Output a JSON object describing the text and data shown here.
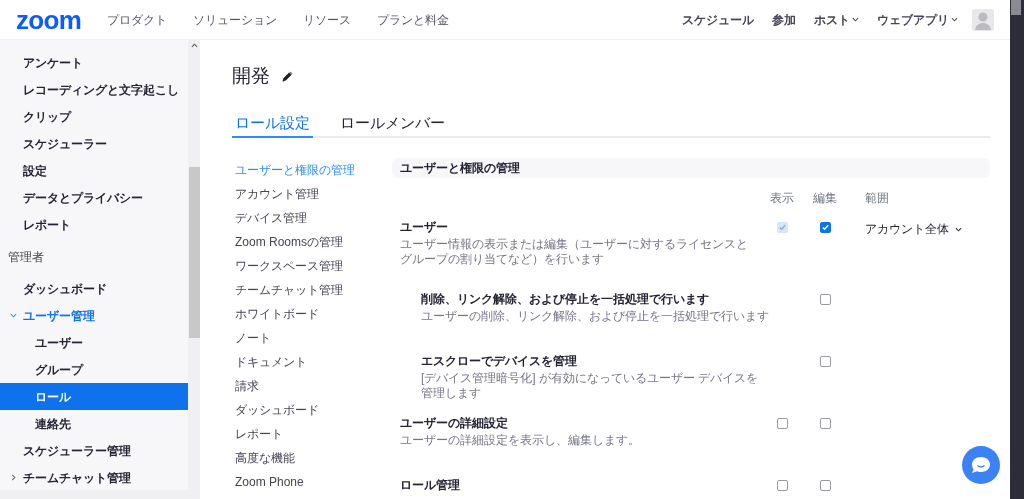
{
  "header": {
    "logo": "zoom",
    "nav_left": [
      "プロダクト",
      "ソリューション",
      "リソース",
      "プランと料金"
    ],
    "nav_right": [
      {
        "label": "スケジュール",
        "dropdown": false
      },
      {
        "label": "参加",
        "dropdown": false
      },
      {
        "label": "ホスト",
        "dropdown": true
      },
      {
        "label": "ウェブアプリ",
        "dropdown": true
      }
    ]
  },
  "sidebar": {
    "items": [
      {
        "kind": "item",
        "label": "アンケート",
        "selected": false
      },
      {
        "kind": "item",
        "label": "レコーディングと文字起こし",
        "selected": false
      },
      {
        "kind": "item",
        "label": "クリップ",
        "selected": false
      },
      {
        "kind": "item",
        "label": "スケジューラー",
        "selected": false
      },
      {
        "kind": "item",
        "label": "設定",
        "selected": false
      },
      {
        "kind": "item",
        "label": "データとプライバシー",
        "selected": false
      },
      {
        "kind": "item",
        "label": "レポート",
        "selected": false
      },
      {
        "kind": "section",
        "label": "管理者"
      },
      {
        "kind": "item",
        "label": "ダッシュボード",
        "selected": false
      },
      {
        "kind": "group",
        "label": "ユーザー管理",
        "expanded": true,
        "children": [
          {
            "kind": "item",
            "label": "ユーザー",
            "selected": false
          },
          {
            "kind": "item",
            "label": "グループ",
            "selected": false
          },
          {
            "kind": "item",
            "label": "ロール",
            "selected": true
          },
          {
            "kind": "item",
            "label": "連絡先",
            "selected": false
          }
        ]
      },
      {
        "kind": "item",
        "label": "スケジューラー管理",
        "selected": false
      },
      {
        "kind": "group",
        "label": "チームチャット管理",
        "expanded": false
      }
    ]
  },
  "page_title": "開発",
  "tabs": [
    {
      "label": "ロール設定",
      "selected": true
    },
    {
      "label": "ロールメンバー",
      "selected": false
    }
  ],
  "subnav": [
    {
      "label": "ユーザーと権限の管理",
      "selected": true
    },
    {
      "label": "アカウント管理",
      "selected": false
    },
    {
      "label": "デバイス管理",
      "selected": false
    },
    {
      "label": "Zoom Roomsの管理",
      "selected": false
    },
    {
      "label": "ワークスペース管理",
      "selected": false
    },
    {
      "label": "チームチャット管理",
      "selected": false
    },
    {
      "label": "ホワイトボード",
      "selected": false
    },
    {
      "label": "ノート",
      "selected": false
    },
    {
      "label": "ドキュメント",
      "selected": false
    },
    {
      "label": "請求",
      "selected": false
    },
    {
      "label": "ダッシュボード",
      "selected": false
    },
    {
      "label": "レポート",
      "selected": false
    },
    {
      "label": "高度な機能",
      "selected": false
    },
    {
      "label": "Zoom Phone",
      "selected": false
    }
  ],
  "section": {
    "title": "ユーザーと権限の管理",
    "columns": [
      "表示",
      "編集",
      "範囲"
    ],
    "permissions": [
      {
        "kind": "main",
        "title": "ユーザー",
        "description": "ユーザー情報の表示または編集（ユーザーに対するライセンスとグループの割り当てなど）を行います",
        "view": {
          "checked": true,
          "disabled": true
        },
        "edit": {
          "checked": true,
          "disabled": false
        },
        "scope": "アカウント全体"
      },
      {
        "kind": "sub",
        "title": "削除、リンク解除、および停止を一括処理で行います",
        "description": "ユーザーの削除、リンク解除、および停止を一括処理で行います",
        "edit": {
          "checked": false,
          "disabled": false
        }
      },
      {
        "kind": "sub",
        "title": "エスクローでデバイスを管理",
        "description": "[デバイス管理暗号化] が有効になっているユーザー デバイスを管理します",
        "edit": {
          "checked": false,
          "disabled": false
        }
      },
      {
        "kind": "main",
        "title": "ユーザーの詳細設定",
        "description": "ユーザーの詳細設定を表示し、編集します。",
        "view": {
          "checked": false,
          "disabled": false
        },
        "edit": {
          "checked": false,
          "disabled": false
        }
      },
      {
        "kind": "main",
        "title": "ロール管理",
        "view": {
          "checked": false,
          "disabled": false
        },
        "edit": {
          "checked": false,
          "disabled": false
        }
      }
    ]
  }
}
